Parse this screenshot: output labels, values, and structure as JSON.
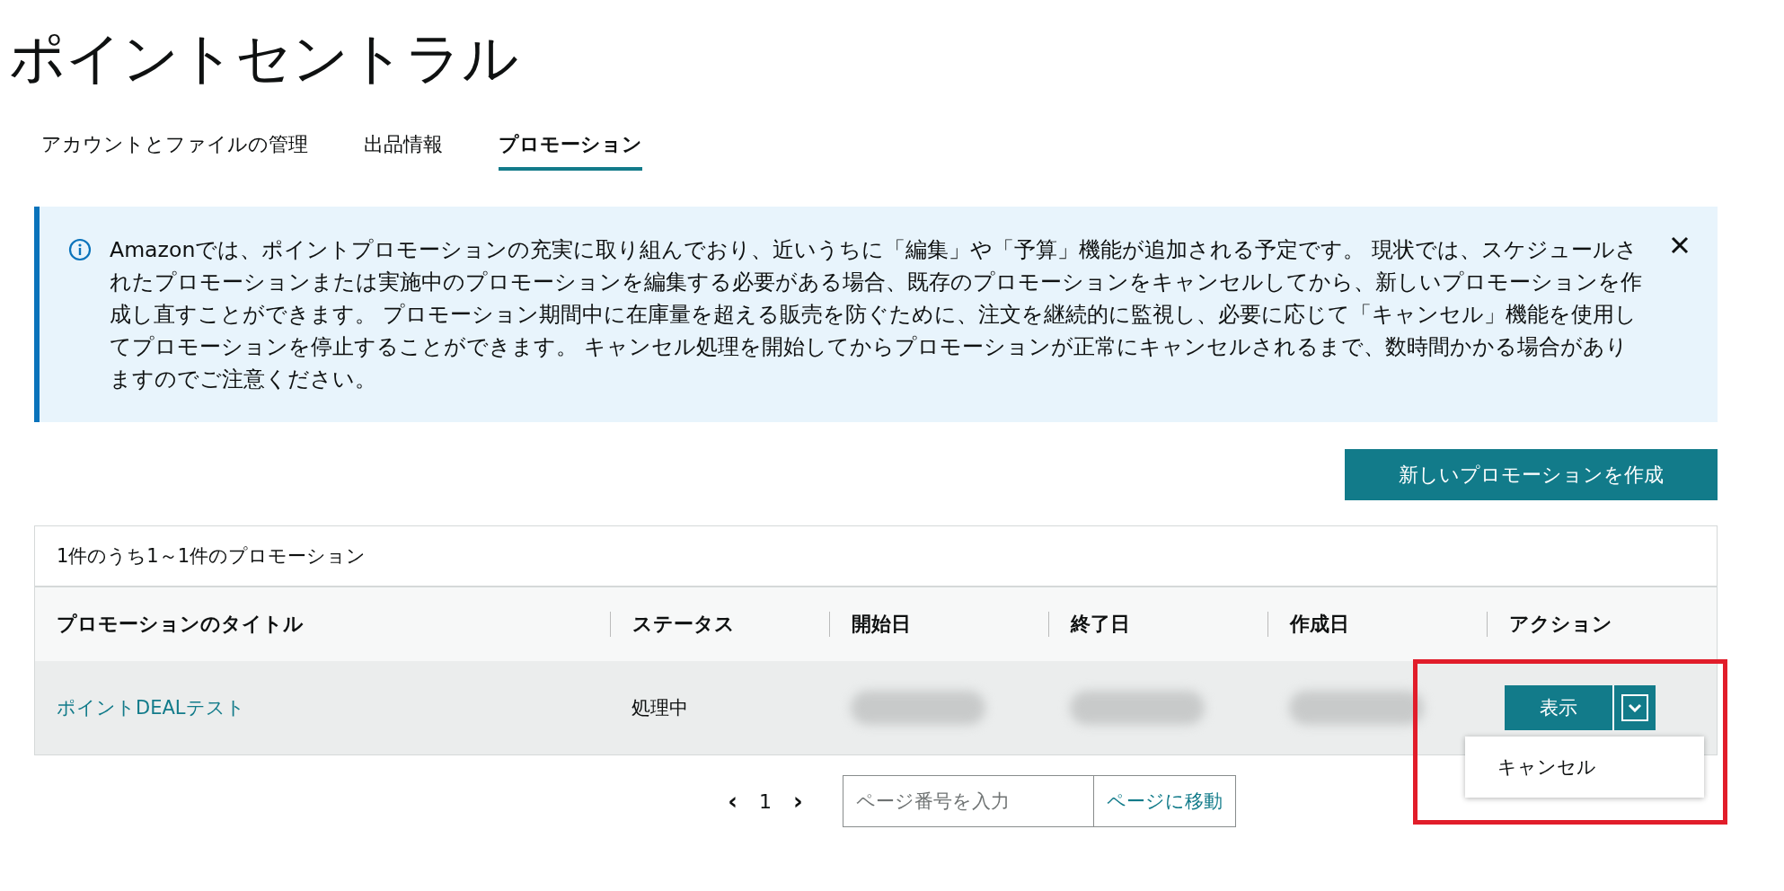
{
  "page_title": "ポイントセントラル",
  "tabs": [
    {
      "label": "アカウントとファイルの管理",
      "selected": false
    },
    {
      "label": "出品情報",
      "selected": false
    },
    {
      "label": "プロモーション",
      "selected": true
    }
  ],
  "info_banner": {
    "text": "Amazonでは、ポイントプロモーションの充実に取り組んでおり、近いうちに「編集」や「予算」機能が追加される予定です。 現状では、スケジュールされたプロモーションまたは実施中のプロモーションを編集する必要がある場合、既存のプロモーションをキャンセルしてから、新しいプロモーションを作成し直すことができます。 プロモーション期間中に在庫量を超える販売を防ぐために、注文を継続的に監視し、必要に応じて「キャンセル」機能を使用してプロモーションを停止することができます。 キャンセル処理を開始してからプロモーションが正常にキャンセルされるまで、数時間かかる場合がありますのでご注意ください。"
  },
  "create_button": "新しいプロモーションを作成",
  "table": {
    "caption": "1件のうち1～1件のプロモーション",
    "columns": [
      "プロモーションのタイトル",
      "ステータス",
      "開始日",
      "終了日",
      "作成日",
      "アクション"
    ],
    "rows": [
      {
        "title": "ポイントDEALテスト",
        "status": "処理中",
        "view_button": "表示",
        "menu": {
          "expanded": true,
          "items": [
            "キャンセル"
          ]
        }
      }
    ]
  },
  "pagination": {
    "prev": "‹",
    "page": "1",
    "next": "›",
    "page_input": {
      "placeholder": "ページ番号を入力"
    },
    "go_button": "ページに移動"
  }
}
